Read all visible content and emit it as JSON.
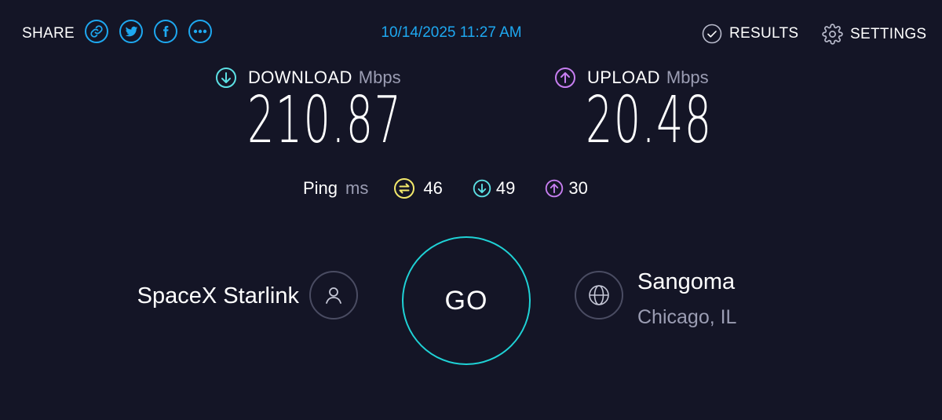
{
  "header": {
    "share_label": "SHARE",
    "share_buttons": [
      {
        "icon": "link-icon"
      },
      {
        "icon": "twitter-icon"
      },
      {
        "icon": "facebook-icon"
      },
      {
        "icon": "more-icon"
      }
    ],
    "timestamp": "10/14/2025 11:27 AM",
    "results_label": "RESULTS",
    "settings_label": "SETTINGS"
  },
  "download": {
    "label": "DOWNLOAD",
    "unit": "Mbps",
    "value": "210.87",
    "color": "#5ce0e4"
  },
  "upload": {
    "label": "UPLOAD",
    "unit": "Mbps",
    "value": "20.48",
    "color": "#c77ef0"
  },
  "ping": {
    "label": "Ping",
    "unit": "ms",
    "idle": "46",
    "download": "49",
    "upload": "30",
    "idle_color": "#f3e96b"
  },
  "isp": {
    "name": "SpaceX Starlink"
  },
  "go_button": {
    "label": "GO",
    "ring_color": "#1fd2d6"
  },
  "server": {
    "name": "Sangoma",
    "location": "Chicago, IL"
  },
  "colors": {
    "background": "#141526",
    "accent": "#1ea8f0",
    "muted": "#9b9db3"
  }
}
